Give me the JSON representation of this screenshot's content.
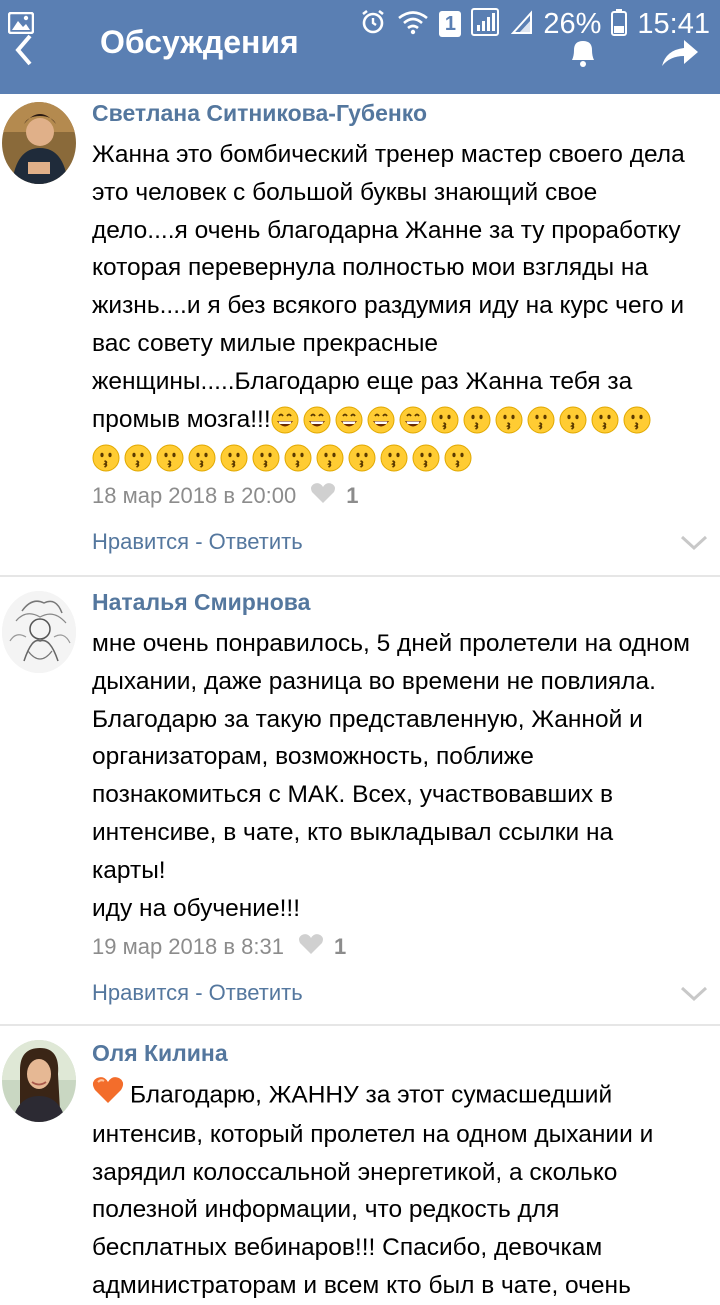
{
  "status_bar": {
    "battery_percent": "26%",
    "time": "15:41",
    "sim_badge": "1"
  },
  "app_bar": {
    "title": "Обсуждения"
  },
  "comments": [
    {
      "author": "Светлана Ситникова-Губенко",
      "lines": [
        "Жанна это бомбический тренер мастер своего дела",
        "это человек с большой буквы знающий свое",
        "дело....я очень благодарна Жанне за ту проработку",
        "которая перевернула полностью мои взгляды на",
        "жизнь....и я без всякого раздумия иду на курс чего и",
        "вас совету милые прекрасные",
        "женщины.....Благодарю еще раз Жанна тебя за",
        "промыв мозга!!!"
      ],
      "date": "18 мар 2018 в 20:00",
      "likes": "1",
      "like_label": "Нравится",
      "separator": " - ",
      "reply_label": "Ответить"
    },
    {
      "author": "Наталья Смирнова",
      "lines": [
        "мне очень понравилось, 5 дней пролетели на одном",
        "дыхании, даже разница во времени не повлияла.",
        "Благодарю за такую представленную, Жанной и",
        "организаторам, возможность, поближе",
        "познакомиться с МАК. Всех, участвовавших в",
        "интенсиве, в чате, кто выкладывал ссылки на",
        "карты!",
        "иду на обучение!!!"
      ],
      "date": "19 мар 2018 в 8:31",
      "likes": "1",
      "like_label": "Нравится",
      "separator": " - ",
      "reply_label": "Ответить"
    },
    {
      "author": "Оля Килина",
      "lines": [
        "Благодарю, ЖАННУ за этот сумасшедший",
        "интенсив, который пролетел на одном дыхании и",
        "зарядил колоссальной энергетикой, а сколько",
        "полезной информации, что редкость для",
        "бесплатных вебинаров!!! Спасибо, девочкам",
        "администраторам и всем кто был в чате, очень"
      ]
    }
  ],
  "icons": {
    "accent": "#5a7fb3",
    "link": "#54779e",
    "emoji_sequence_1": [
      "grin",
      "grin",
      "grin",
      "grin",
      "grin",
      "kiss",
      "kiss",
      "kiss",
      "kiss",
      "kiss",
      "kiss",
      "kiss"
    ],
    "emoji_sequence_2": [
      "kiss",
      "kiss",
      "kiss",
      "kiss",
      "kiss",
      "kiss",
      "kiss",
      "kiss",
      "kiss",
      "kiss",
      "kiss",
      "kiss"
    ]
  }
}
